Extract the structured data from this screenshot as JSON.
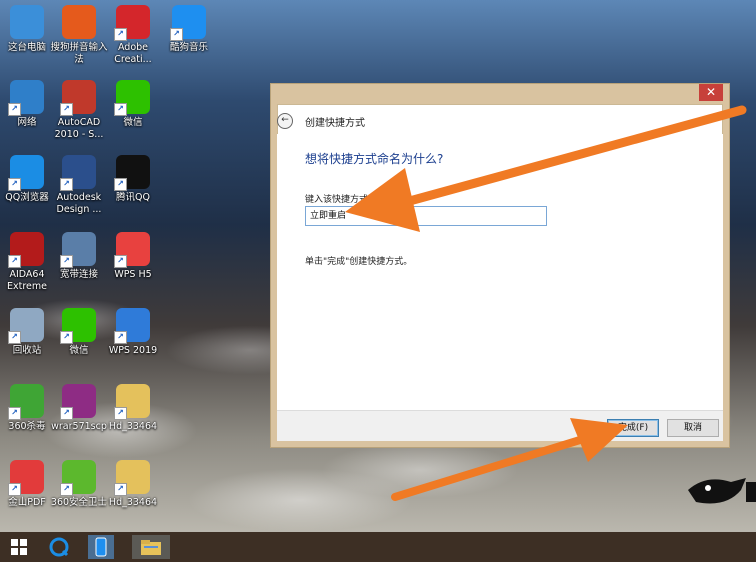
{
  "desktop": {
    "icons": [
      {
        "label": "这台电脑",
        "icon": "computer-icon",
        "color": "#3b8fd9"
      },
      {
        "label": "搜狗拼音输入法",
        "icon": "sogou-icon",
        "color": "#e55a1c"
      },
      {
        "label": "Adobe Creati...",
        "icon": "adobe-cc-icon",
        "color": "#d4262b"
      },
      {
        "label": "酷狗音乐",
        "icon": "kugou-icon",
        "color": "#1e8ff0"
      },
      {
        "label": "网络",
        "icon": "network-icon",
        "color": "#2f7fc9"
      },
      {
        "label": "AutoCAD 2010 - S...",
        "icon": "autocad-icon",
        "color": "#c0392b"
      },
      {
        "label": "微信",
        "icon": "wechat-icon",
        "color": "#2dc100"
      },
      {
        "label": "QQ浏览器",
        "icon": "qq-browser-icon",
        "color": "#1b8de4"
      },
      {
        "label": "Autodesk Design ...",
        "icon": "autodesk-review-icon",
        "color": "#2b4f8c"
      },
      {
        "label": "腾讯QQ",
        "icon": "qq-icon",
        "color": "#111111"
      },
      {
        "label": "AIDA64 Extreme",
        "icon": "aida64-icon",
        "color": "#b31b1b"
      },
      {
        "label": "宽带连接",
        "icon": "broadband-icon",
        "color": "#5a7ea8"
      },
      {
        "label": "WPS H5",
        "icon": "wps-h5-icon",
        "color": "#e8413f"
      },
      {
        "label": "回收站",
        "icon": "recycle-bin-icon",
        "color": "#8fa8c2"
      },
      {
        "label": "微信",
        "icon": "wechat-icon",
        "color": "#2dc100"
      },
      {
        "label": "WPS 2019",
        "icon": "wps-icon",
        "color": "#2f7bd9"
      },
      {
        "label": "360杀毒",
        "icon": "360-antivirus-icon",
        "color": "#3fa535"
      },
      {
        "label": "wrar571scp",
        "icon": "winrar-icon",
        "color": "#8e2c84"
      },
      {
        "label": "Hd_33464",
        "icon": "folder-zip-icon",
        "color": "#e4c15c"
      },
      {
        "label": "金山PDF",
        "icon": "kingsoft-pdf-icon",
        "color": "#e23b3b"
      },
      {
        "label": "360安全卫士",
        "icon": "360-security-icon",
        "color": "#5cb82d"
      },
      {
        "label": "Hd_33464",
        "icon": "folder-zip-icon",
        "color": "#e4c15c"
      }
    ]
  },
  "dialog": {
    "close_glyph": "✕",
    "back_glyph": "←",
    "title": "创建快捷方式",
    "heading": "想将快捷方式命名为什么?",
    "field_label": "键入该快捷方式的名",
    "input_value": "立即重启",
    "hint": "单击\"完成\"创建快捷方式。",
    "finish_label": "完成(F)",
    "cancel_label": "取消"
  },
  "colors": {
    "dialog_frame": "#d9c3a0",
    "close_button": "#c7403a",
    "heading_text": "#1c3f8f",
    "arrow": "#f07a24"
  },
  "taskbar": {
    "items": [
      "windows-start-icon",
      "qq-browser-icon",
      "phone-icon",
      "file-explorer-icon"
    ]
  }
}
